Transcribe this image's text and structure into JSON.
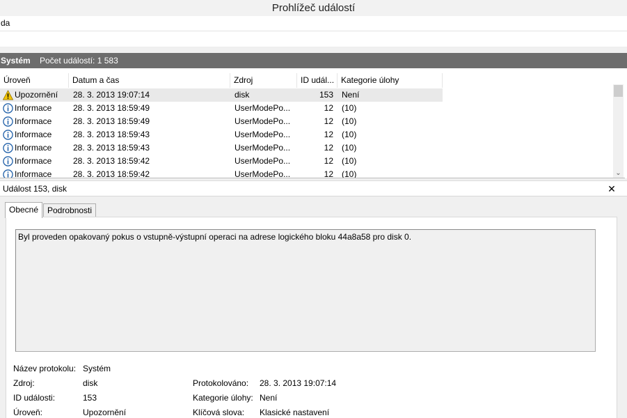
{
  "window": {
    "title": "Prohlížeč událostí"
  },
  "menubar": {
    "text": "da"
  },
  "log": {
    "name": "Systém",
    "count_label": "Počet událostí: 1 583"
  },
  "columns": [
    "Úroveň",
    "Datum a čas",
    "Zdroj",
    "ID udál...",
    "Kategorie úlohy"
  ],
  "events": [
    {
      "level": "Upozornění",
      "level_icon": "warning-icon",
      "datetime": "28. 3. 2013 19:07:14",
      "source": "disk",
      "id": "153",
      "category": "Není"
    },
    {
      "level": "Informace",
      "level_icon": "info-icon",
      "datetime": "28. 3. 2013 18:59:49",
      "source": "UserModePo...",
      "id": "12",
      "category": "(10)"
    },
    {
      "level": "Informace",
      "level_icon": "info-icon",
      "datetime": "28. 3. 2013 18:59:49",
      "source": "UserModePo...",
      "id": "12",
      "category": "(10)"
    },
    {
      "level": "Informace",
      "level_icon": "info-icon",
      "datetime": "28. 3. 2013 18:59:43",
      "source": "UserModePo...",
      "id": "12",
      "category": "(10)"
    },
    {
      "level": "Informace",
      "level_icon": "info-icon",
      "datetime": "28. 3. 2013 18:59:43",
      "source": "UserModePo...",
      "id": "12",
      "category": "(10)"
    },
    {
      "level": "Informace",
      "level_icon": "info-icon",
      "datetime": "28. 3. 2013 18:59:42",
      "source": "UserModePo...",
      "id": "12",
      "category": "(10)"
    },
    {
      "level": "Informace",
      "level_icon": "info-icon",
      "datetime": "28. 3. 2013 18:59:42",
      "source": "UserModePo...",
      "id": "12",
      "category": "(10)"
    }
  ],
  "detail": {
    "title": "Událost 153, disk",
    "close_glyph": "✕",
    "tabs": [
      "Obecné",
      "Podrobnosti"
    ],
    "message": "Byl proveden opakovaný pokus o vstupně-výstupní operaci na adrese logického bloku 44a8a58 pro disk 0.",
    "props": {
      "log_name_label": "Název protokolu:",
      "log_name": "Systém",
      "source_label": "Zdroj:",
      "source": "disk",
      "logged_label": "Protokolováno:",
      "logged": "28. 3. 2013 19:07:14",
      "event_id_label": "ID události:",
      "event_id": "153",
      "task_category_label": "Kategorie úlohy:",
      "task_category": "Není",
      "level_label": "Úroveň:",
      "level": "Upozornění",
      "keywords_label": "Klíčová slova:",
      "keywords": "Klasické nastavení"
    }
  },
  "colors": {
    "log_header_bg": "#6d6d6d",
    "selected_row": "#e9e9e9",
    "warning": "#f2c400",
    "info": "#1f5fa8"
  }
}
